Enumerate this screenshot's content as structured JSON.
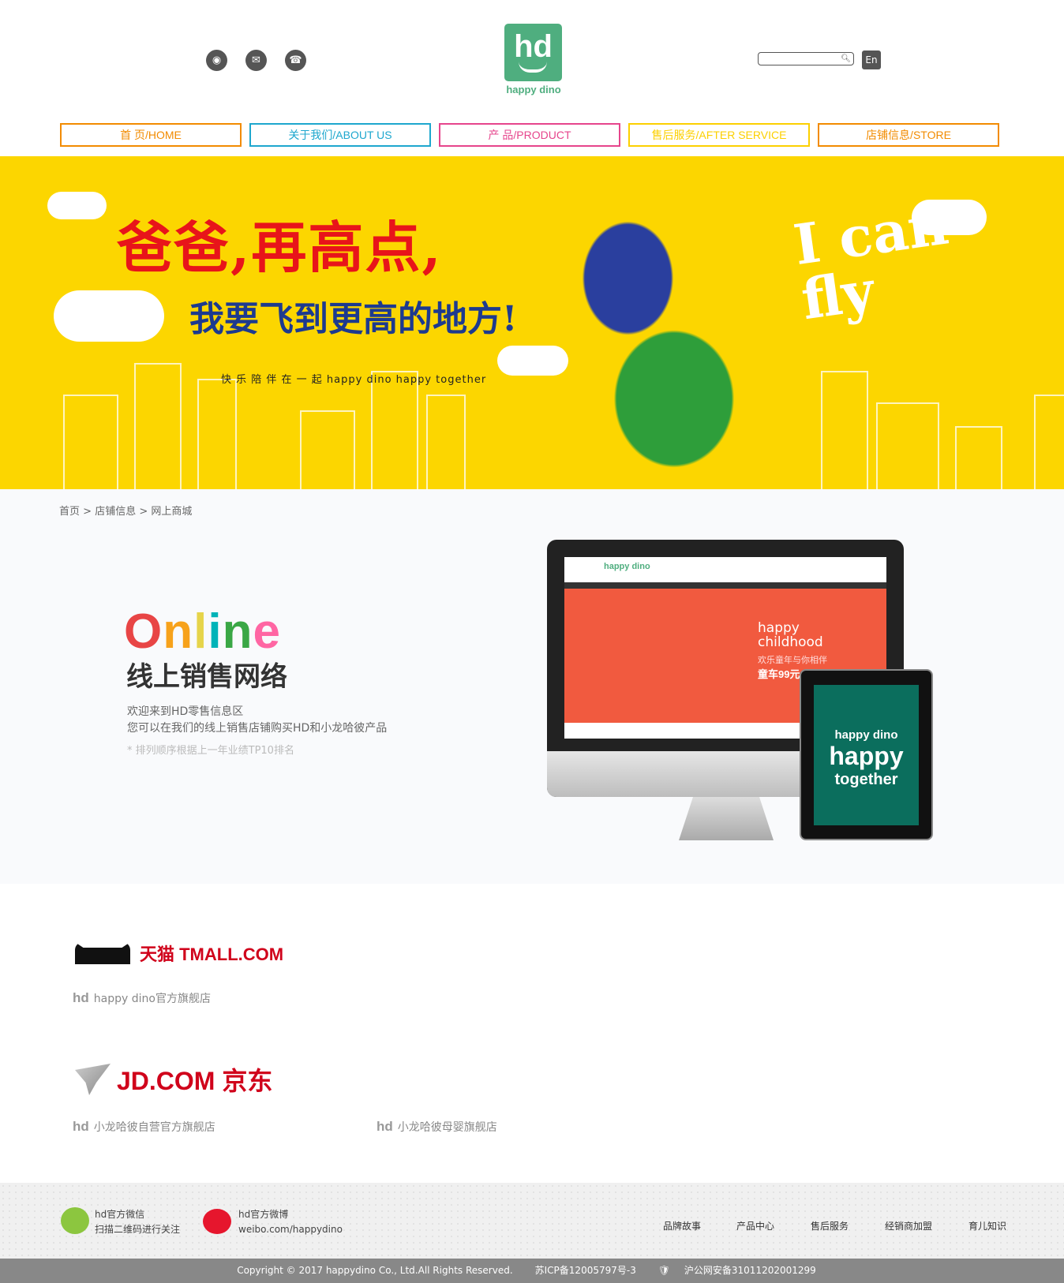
{
  "header": {
    "logo_text": "hd",
    "brand": "happy dino",
    "search_placeholder": "",
    "lang_button": "En",
    "social": [
      "weibo-icon",
      "wechat-icon",
      "phone-icon"
    ]
  },
  "nav": [
    {
      "label": "首 页/HOME",
      "color": "#f28b00"
    },
    {
      "label": "关于我们/ABOUT US",
      "color": "#1ea7ce"
    },
    {
      "label": "产 品/PRODUCT",
      "color": "#e6458c"
    },
    {
      "label": "售后服务/AFTER SERVICE",
      "color": "#fcd000"
    },
    {
      "label": "店铺信息/STORE",
      "color": "#f28b00"
    }
  ],
  "banner": {
    "line1": "爸爸,再高点,",
    "line2": "我要飞到更高的地方!",
    "line3": "快 乐  陪 伴 在 一 起   happy dino happy together",
    "fly": "I can fly"
  },
  "breadcrumb": [
    "首页",
    "店铺信息",
    "网上商城"
  ],
  "online": {
    "title_letters": [
      {
        "c": "O",
        "color": "#e84545"
      },
      {
        "c": "n",
        "color": "#f7a21b"
      },
      {
        "c": "l",
        "color": "#e6d44a"
      },
      {
        "c": "i",
        "color": "#00b3b8"
      },
      {
        "c": "n",
        "color": "#3aa745"
      },
      {
        "c": "e",
        "color": "#ff66a3"
      }
    ],
    "subtitle": "线上销售网络",
    "desc1": "欢迎来到HD零售信息区",
    "desc2": "您可以在我们的线上销售店铺购买HD和小龙哈彼产品",
    "note": "* 排列顺序根据上一年业绩TP10排名"
  },
  "mockup": {
    "site_name": "happy dino",
    "headline1": "happy",
    "headline2": "childhood",
    "tagline": "欢乐童年与你相伴",
    "price": "童车99元",
    "tablet_text1": "happy dino",
    "tablet_text2": "happy",
    "tablet_text3": "together"
  },
  "stores": {
    "tmall_logo": "天猫 TMALL.COM",
    "tmall_links": [
      "happy dino官方旗舰店"
    ],
    "jd_logo": "JD.COM 京东",
    "jd_links": [
      "小龙哈彼自营官方旗舰店",
      "小龙哈彼母婴旗舰店"
    ]
  },
  "footer": {
    "wechat_title": "hd官方微信",
    "wechat_sub": "扫描二维码进行关注",
    "weibo_title": "hd官方微博",
    "weibo_sub": "weibo.com/happydino",
    "links": [
      "品牌故事",
      "产品中心",
      "售后服务",
      "经销商加盟",
      "育儿知识"
    ],
    "copyright": "Copyright © 2017 happydino Co., Ltd.All Rights Reserved.",
    "icp": "苏ICP备12005797号-3",
    "police": "沪公网安备31011202001299"
  }
}
